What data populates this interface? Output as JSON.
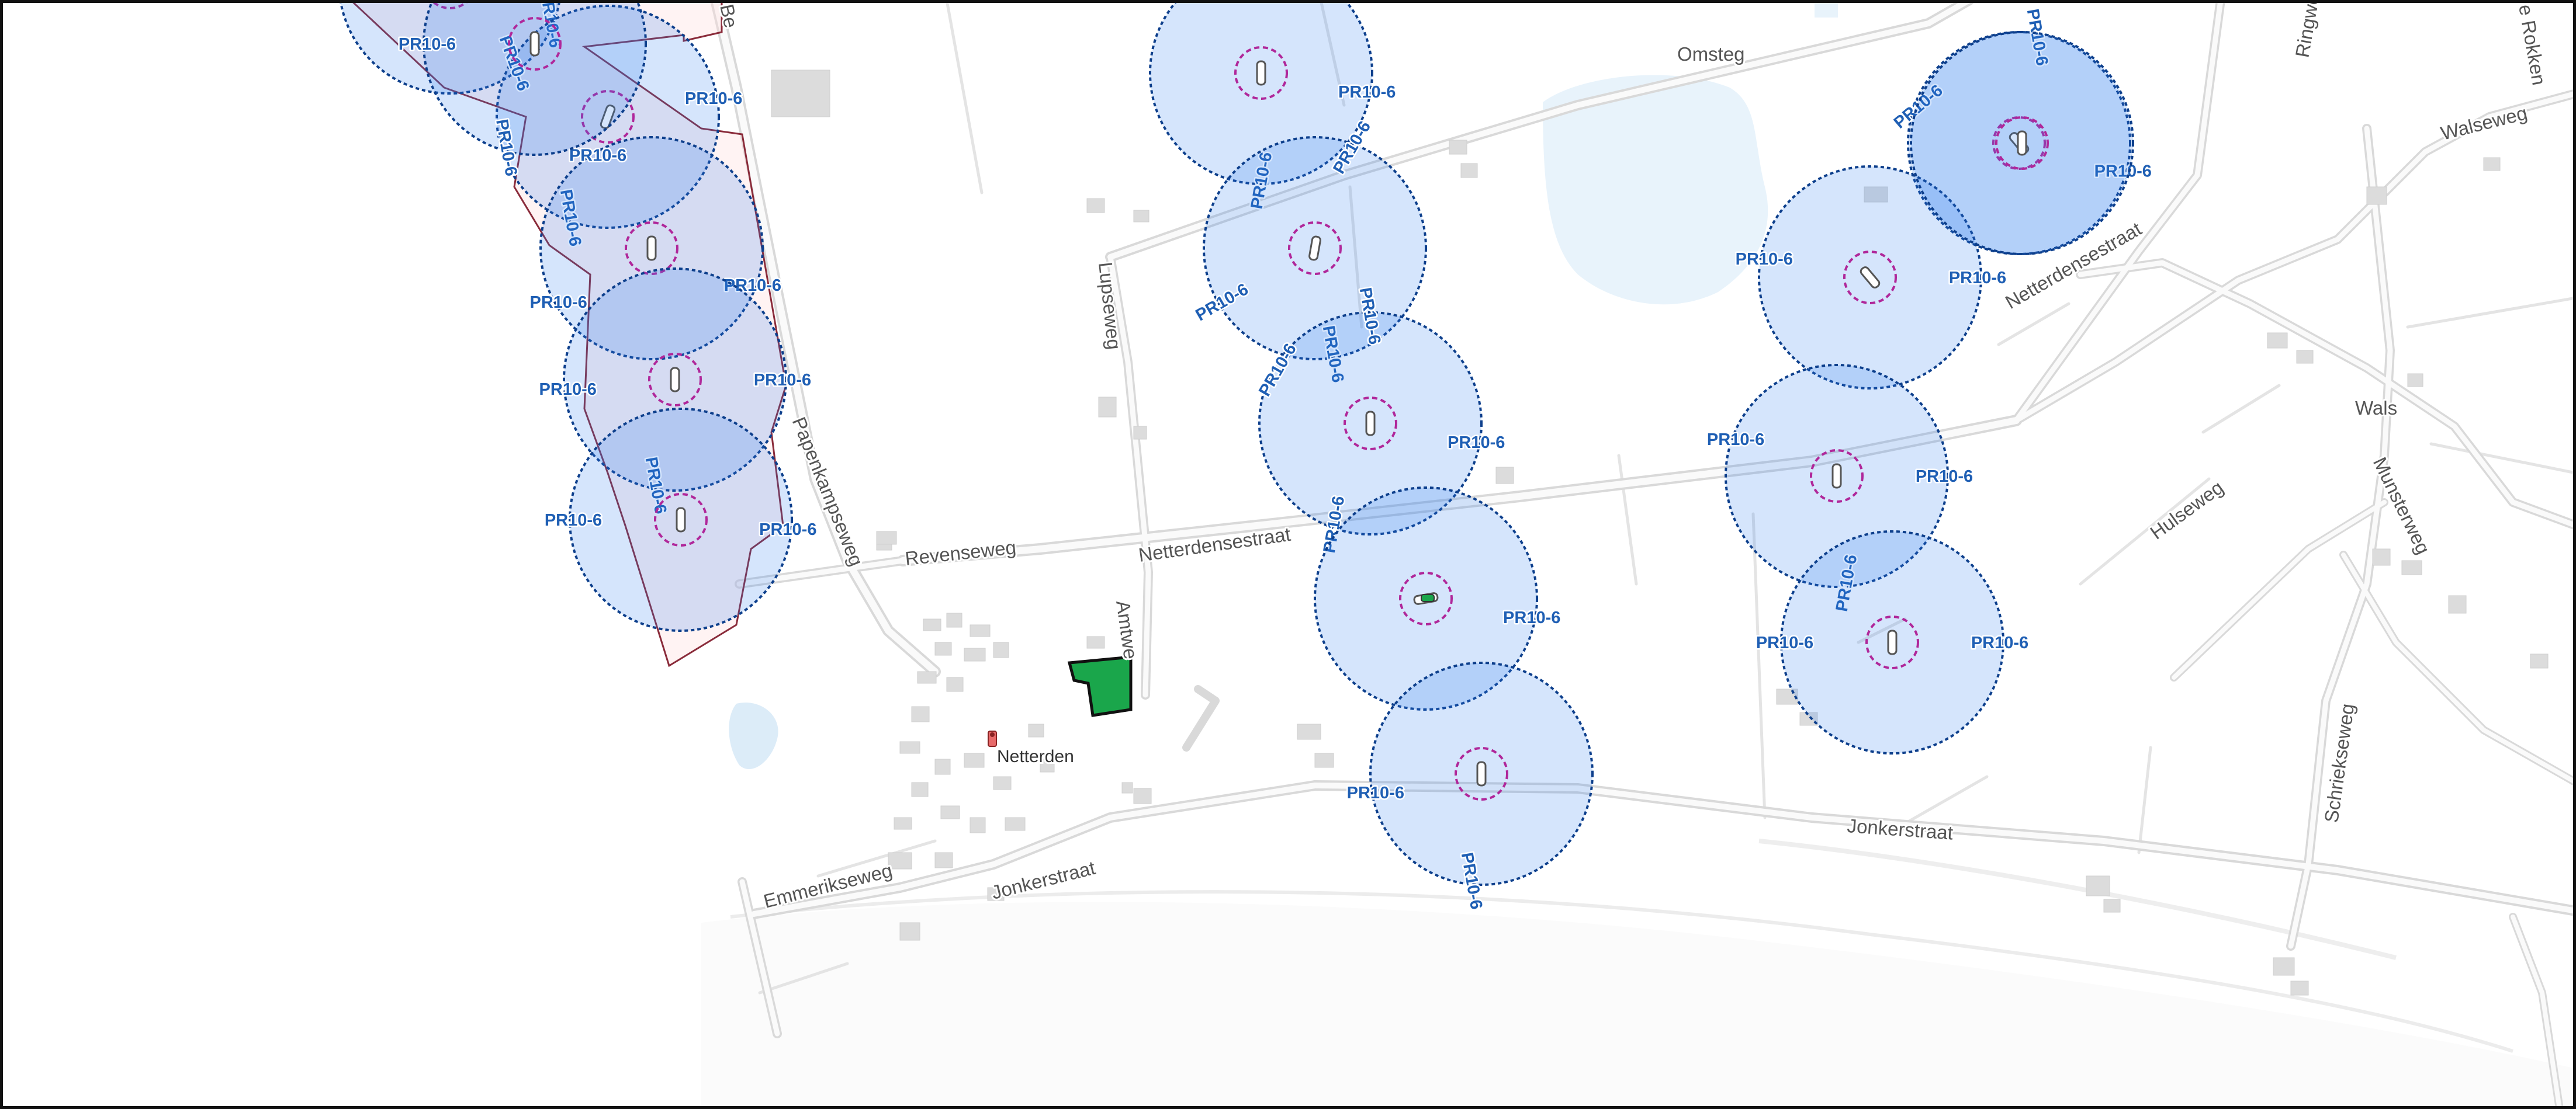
{
  "colors": {
    "buffer_fill": "#cfe2ff",
    "buffer_stroke": "#0d3f8c",
    "inner_ring": "#b0279a",
    "buffer_label": "#1f5fb4",
    "zone_outline": "#8a2b3a",
    "site_fill": "#1aa64b",
    "water": "#e8f3fb",
    "road": "#f7f7f7"
  },
  "icons": {
    "site": "site-polygon",
    "place_marker": "location-marker-icon"
  },
  "buffer_label": "PR10-6",
  "streets": {
    "omsteg": "Omsteg",
    "walseweg": "Walseweg",
    "ringweg": "Ringwe",
    "rokken": "e Rokken",
    "lupseweg": "Lupseweg",
    "papenkampseweg": "Papenkampseweg",
    "revenseweg": "Revenseweg",
    "netterdensestraat_west": "Netterdensestraat",
    "netterdensestraat_east": "Netterdensestraat",
    "amtweg": "Amtwe",
    "wals": "Wals",
    "hulseweg": "Hulseweg",
    "munsterweg": "Munsterweg",
    "schriekseweg": "Schriekseweg",
    "jonkerstraat_east": "Jonkerstraat",
    "jonkerstraat_west": "Jonkerstraat",
    "emmerikseweg": "Emmerikseweg",
    "top_west": "Be"
  },
  "places": {
    "netterden": "Netterden"
  },
  "buffers": [
    "PR10-6",
    "PR10-6",
    "PR10-6",
    "PR10-6",
    "PR10-6",
    "PR10-6",
    "PR10-6",
    "PR10-6",
    "PR10-6",
    "PR10-6",
    "PR10-6",
    "PR10-6",
    "PR10-6",
    "PR10-6",
    "PR10-6",
    "PR10-6"
  ]
}
